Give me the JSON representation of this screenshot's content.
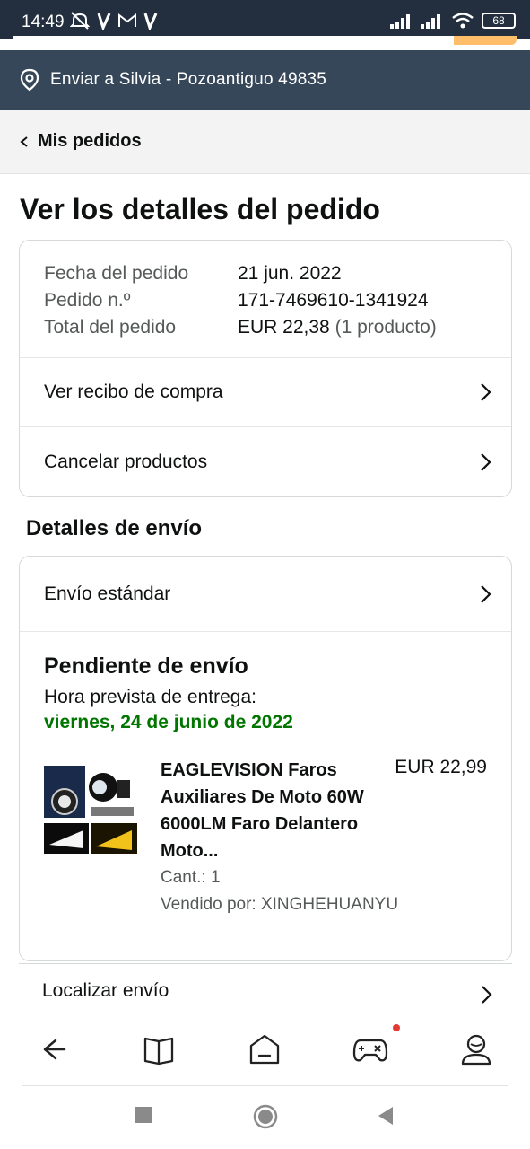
{
  "status_bar": {
    "time": "14:49",
    "battery": "68",
    "left_icons": [
      "mute-icon",
      "v-icon",
      "gmail-icon",
      "v-icon"
    ],
    "right_icons": [
      "signal-icon",
      "signal-icon",
      "wifi-icon",
      "battery-icon"
    ]
  },
  "deliver_to": {
    "text": "Enviar a Silvia - Pozoantiguo 49835",
    "icon": "location-pin-icon"
  },
  "breadcrumb": {
    "label": "Mis pedidos"
  },
  "page_title": "Ver los detalles del pedido",
  "order_summary": {
    "date_label": "Fecha del pedido",
    "date_value": "21 jun. 2022",
    "number_label": "Pedido n.º",
    "number_value": "171-7469610-1341924",
    "total_label": "Total del pedido",
    "total_value": "EUR 22,38",
    "total_note": "(1 producto)",
    "links": [
      "Ver recibo de compra",
      "Cancelar productos"
    ]
  },
  "shipping": {
    "section_title": "Detalles de envío",
    "method": "Envío estándar",
    "status_title": "Pendiente de envío",
    "eta_label": "Hora prevista de entrega:",
    "eta_date": "viernes, 24 de junio de 2022",
    "product": {
      "title": "EAGLEVISION Faros Auxiliares De Moto 60W 6000LM Faro Delantero Moto...",
      "price": "EUR 22,99",
      "quantity": "Cant.: 1",
      "seller": "Vendido por: XINGHEHUANYU"
    },
    "track_label": "Localizar envío"
  },
  "bottom_nav": {
    "items": [
      "back-icon",
      "book-icon",
      "home-icon",
      "gamepad-icon",
      "profile-icon"
    ]
  },
  "colors": {
    "header_dark": "#232f3e",
    "deliver_bar": "#37475a",
    "eta_green": "#007600",
    "notification_dot": "#e53935"
  }
}
